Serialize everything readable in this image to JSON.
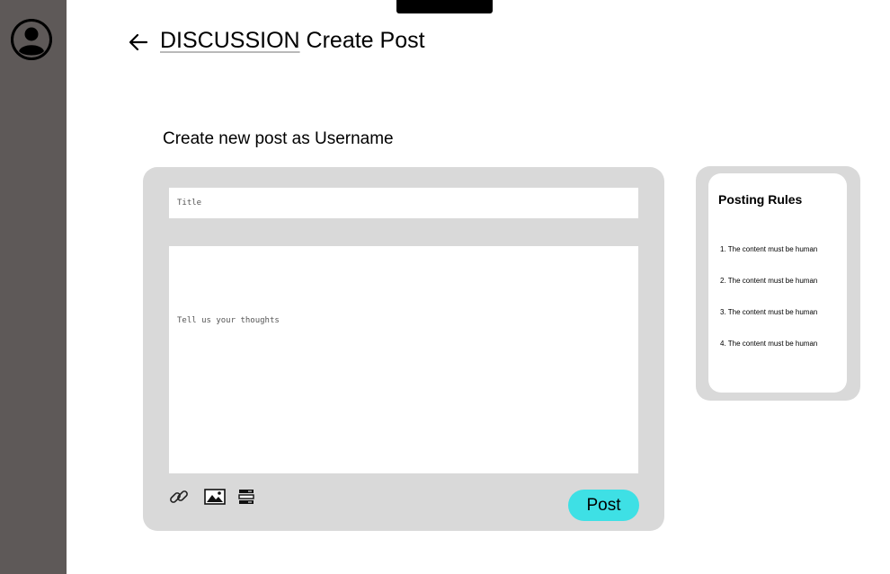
{
  "header": {
    "category": "DISCUSSION",
    "title": "Create Post"
  },
  "composer": {
    "heading": "Create new post as Username",
    "title_placeholder": "Title",
    "body_placeholder": "Tell us your thoughts",
    "post_label": "Post",
    "accent_color": "#3ee0e5",
    "toolbar_icons": [
      "link-icon",
      "image-icon",
      "list-icon"
    ]
  },
  "rules": {
    "title": "Posting Rules",
    "items": [
      "1. The content must be human",
      "2. The content must be human",
      "3. The content must be human",
      "4. The content must be human"
    ]
  },
  "colors": {
    "sidebar": "#5e5958",
    "card": "#d9d9d9"
  }
}
